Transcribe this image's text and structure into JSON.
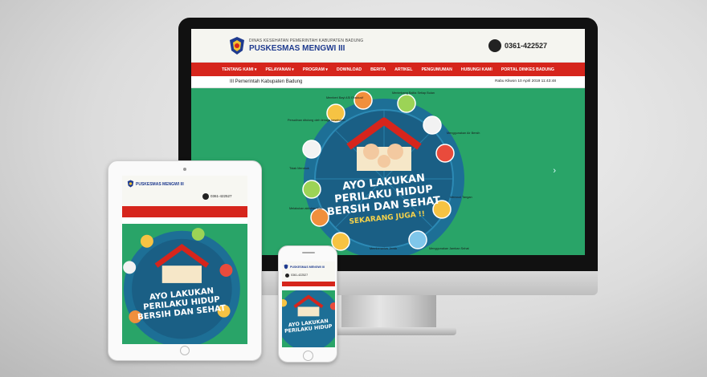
{
  "site": {
    "org_name": "DINAS KESEHATAN PEMERINTAH KABUPATEN BADUNG",
    "name": "PUSKESMAS MENGWI III",
    "phone": "0361-422527",
    "nav": [
      "TENTANG KAMI ▾",
      "PELAYANAN ▾",
      "PROGRAM ▾",
      "DOWNLOAD",
      "BERITA",
      "ARTIKEL",
      "PENGUMUMAN",
      "HUBUNGI KAMI",
      "PORTAL DINKES BADUNG"
    ],
    "ticker": "III Pemerintah Kabupaten Badung",
    "date": "Rabu Kliwon 10 April 2019 11:43:48"
  },
  "poster": {
    "line1": "AYO LAKUKAN",
    "line2": "PERILAKU HIDUP",
    "line3": "BERSIH DAN SEHAT",
    "line4": "SEKARANG JUGA !!",
    "labels": [
      "Memberi Bayi ASI Eksklusif",
      "Menimbang Balita Setiap Bulan",
      "Persalinan ditolong oleh tenaga kesehatan",
      "Menggunakan Air Bersih",
      "Tidak Merokok",
      "Mencuci Tangan",
      "Melakukan aktivitas fisik",
      "Memberantas Jentik",
      "Makan Buah dan Sayur",
      "Menggunakan Jamban Sehat"
    ]
  },
  "hero": {
    "next_icon": "chevron-right-icon",
    "next": "›"
  },
  "colors": {
    "nav_red": "#d6251c",
    "hero_green": "#29a468",
    "brand_blue": "#1f3b8f"
  }
}
